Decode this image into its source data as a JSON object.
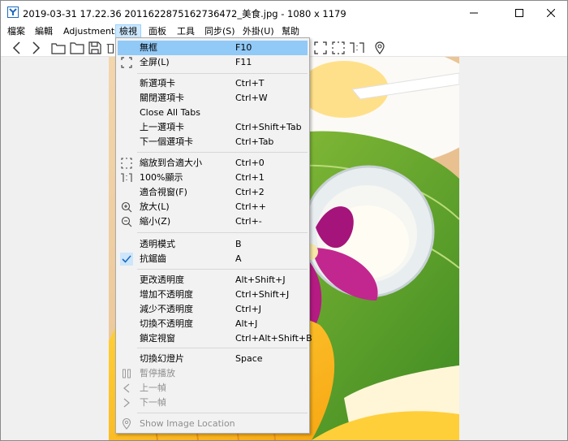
{
  "window": {
    "title": "2019-03-31 17.22.36 2011622875162736472_美食.jpg - 1080 x 1179",
    "minimize_glyph": "─",
    "maximize_glyph": "☐",
    "close_glyph": "✕"
  },
  "menubar": {
    "items": [
      "檔案",
      "編輯",
      "Adjustments",
      "檢視",
      "面板",
      "工具",
      "同步(S)",
      "外掛(U)",
      "幫助"
    ],
    "active_index": 3
  },
  "view_menu": {
    "items": [
      {
        "label": "無框",
        "shortcut": "F10",
        "icon": "",
        "highlighted": true
      },
      {
        "label": "全屏(L)",
        "shortcut": "F11",
        "icon": "fullscreen-icon"
      },
      {
        "label": "新選項卡",
        "shortcut": "Ctrl+T",
        "icon": ""
      },
      {
        "label": "關閉選項卡",
        "shortcut": "Ctrl+W",
        "icon": ""
      },
      {
        "label": "Close All Tabs",
        "shortcut": "",
        "icon": ""
      },
      {
        "label": "上一選項卡",
        "shortcut": "Ctrl+Shift+Tab",
        "icon": ""
      },
      {
        "label": "下一個選項卡",
        "shortcut": "Ctrl+Tab",
        "icon": ""
      },
      {
        "label": "縮放到合適大小",
        "shortcut": "Ctrl+0",
        "icon": "zoom-fit-icon"
      },
      {
        "label": "100%顯示",
        "shortcut": "Ctrl+1",
        "icon": "actual-size-icon"
      },
      {
        "label": "適合視窗(F)",
        "shortcut": "Ctrl+2",
        "icon": ""
      },
      {
        "label": "放大(L)",
        "shortcut": "Ctrl++",
        "icon": "zoom-in-icon"
      },
      {
        "label": "縮小(Z)",
        "shortcut": "Ctrl+-",
        "icon": "zoom-out-icon"
      },
      {
        "label": "透明模式",
        "shortcut": "B",
        "icon": ""
      },
      {
        "label": "抗鋸齒",
        "shortcut": "A",
        "icon": "checkmark-icon",
        "checked": true
      },
      {
        "label": "更改透明度",
        "shortcut": "Alt+Shift+J",
        "icon": ""
      },
      {
        "label": "增加不透明度",
        "shortcut": "Ctrl+Shift+J",
        "icon": ""
      },
      {
        "label": "減少不透明度",
        "shortcut": "Ctrl+J",
        "icon": ""
      },
      {
        "label": "切換不透明度",
        "shortcut": "Alt+J",
        "icon": ""
      },
      {
        "label": "鎖定視窗",
        "shortcut": "Ctrl+Alt+Shift+B",
        "icon": ""
      },
      {
        "label": "切換幻燈片",
        "shortcut": "Space",
        "icon": ""
      },
      {
        "label": "暫停播放",
        "shortcut": "",
        "icon": "pause-icon",
        "disabled": true
      },
      {
        "label": "上一幀",
        "shortcut": "",
        "icon": "previous-frame-icon",
        "disabled": true
      },
      {
        "label": "下一幀",
        "shortcut": "",
        "icon": "next-frame-icon",
        "disabled": true
      },
      {
        "label": "Show Image Location",
        "shortcut": "",
        "icon": "location-pin-icon",
        "disabled": true
      }
    ]
  },
  "colors": {
    "highlight": "#91c9f7",
    "menubar_active": "#cce8ff",
    "menu_bg": "#f2f2f2",
    "disabled_text": "#8f8f8f",
    "accent_blue": "#1c6bbf"
  }
}
